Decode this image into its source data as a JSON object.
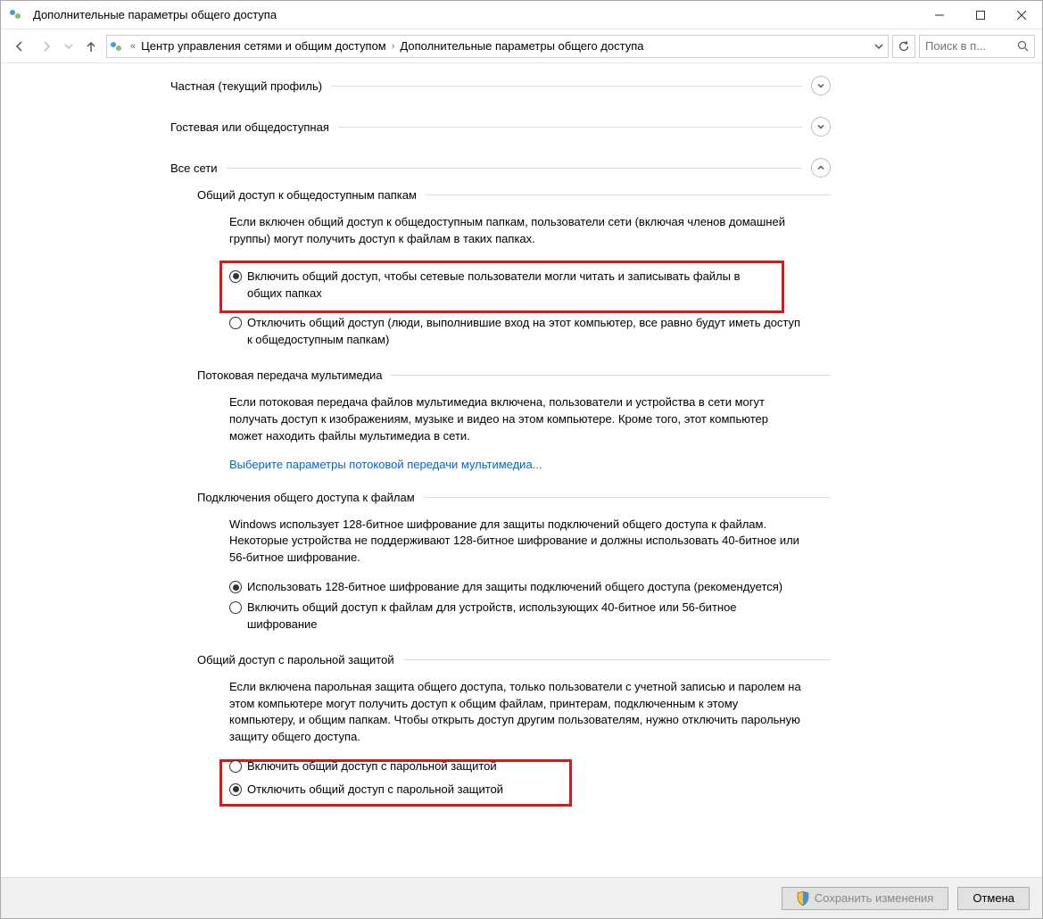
{
  "window": {
    "title": "Дополнительные параметры общего доступа"
  },
  "nav": {
    "crumb1": "Центр управления сетями и общим доступом",
    "crumb2": "Дополнительные параметры общего доступа",
    "search_placeholder": "Поиск в п..."
  },
  "sections": {
    "private": {
      "label": "Частная (текущий профиль)"
    },
    "guest": {
      "label": "Гостевая или общедоступная"
    },
    "all": {
      "label": "Все сети"
    }
  },
  "public_folders": {
    "title": "Общий доступ к общедоступным папкам",
    "desc": "Если включен общий доступ к общедоступным папкам, пользователи сети (включая членов домашней группы) могут получить доступ к файлам в таких папках.",
    "opt_on": "Включить общий доступ, чтобы сетевые пользователи могли читать и записывать файлы в общих папках",
    "opt_off": "Отключить общий доступ (люди, выполнившие вход на этот компьютер, все равно будут иметь доступ к общедоступным папкам)"
  },
  "media": {
    "title": "Потоковая передача мультимедиа",
    "desc": "Если потоковая передача файлов мультимедиа включена, пользователи и устройства в сети могут получать доступ к изображениям, музыке и видео на этом компьютере. Кроме того, этот компьютер может находить файлы мультимедиа в сети.",
    "link": "Выберите параметры потоковой передачи мультимедиа..."
  },
  "file_encryption": {
    "title": "Подключения общего доступа к файлам",
    "desc": "Windows использует 128-битное шифрование для защиты подключений общего доступа к файлам. Некоторые устройства не поддерживают 128-битное шифрование и должны использовать 40-битное или 56-битное шифрование.",
    "opt_128": "Использовать 128-битное шифрование для защиты подключений общего доступа (рекомендуется)",
    "opt_4056": "Включить общий доступ к файлам для устройств, использующих 40-битное или 56-битное шифрование"
  },
  "password": {
    "title": "Общий доступ с парольной защитой",
    "desc": "Если включена парольная защита общего доступа, только пользователи с учетной записью и паролем на этом компьютере могут получить доступ к общим файлам, принтерам, подключенным к этому компьютеру, и общим папкам. Чтобы открыть доступ другим пользователям, нужно отключить парольную защиту общего доступа.",
    "opt_on": "Включить общий доступ с парольной защитой",
    "opt_off": "Отключить общий доступ с парольной защитой"
  },
  "footer": {
    "save": "Сохранить изменения",
    "cancel": "Отмена"
  }
}
